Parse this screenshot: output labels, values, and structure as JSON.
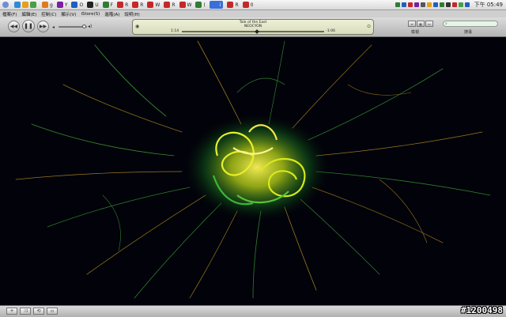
{
  "taskbar": {
    "items": [
      {
        "label": "g",
        "color": "#e07a1f"
      },
      {
        "label": "Y",
        "color": "#7b1fa2"
      },
      {
        "label": "O",
        "color": "#1f5fbf"
      },
      {
        "label": "U",
        "color": "#222222"
      },
      {
        "label": "F",
        "color": "#2e7d32"
      },
      {
        "label": "R",
        "color": "#c62828"
      },
      {
        "label": "R",
        "color": "#c62828"
      },
      {
        "label": "W",
        "color": "#c62828"
      },
      {
        "label": "R",
        "color": "#c62828"
      },
      {
        "label": "W",
        "color": "#c62828"
      },
      {
        "label": "(",
        "color": "#2e7d32"
      },
      {
        "label": "i",
        "color": "#3a6fd8"
      },
      {
        "label": "R",
        "color": "#c62828"
      },
      {
        "label": "0",
        "color": "#c62828"
      }
    ],
    "active_index": 11,
    "clock": "下午 05:49"
  },
  "menubar": {
    "items": [
      "檔案(F)",
      "編輯(E)",
      "控制(C)",
      "顯示(V)",
      "iStore(S)",
      "進階(A)",
      "說明(H)"
    ]
  },
  "player": {
    "app_title": "iTunes",
    "track_title": "Tale of the East",
    "artist": "NEOCYON",
    "elapsed": "1:14",
    "remaining": "-1:06",
    "progress": 0.53,
    "volume": 0.9,
    "view_label": "檢視",
    "search_label": "搜尋",
    "search_placeholder": ""
  },
  "watermark": "#1200498"
}
